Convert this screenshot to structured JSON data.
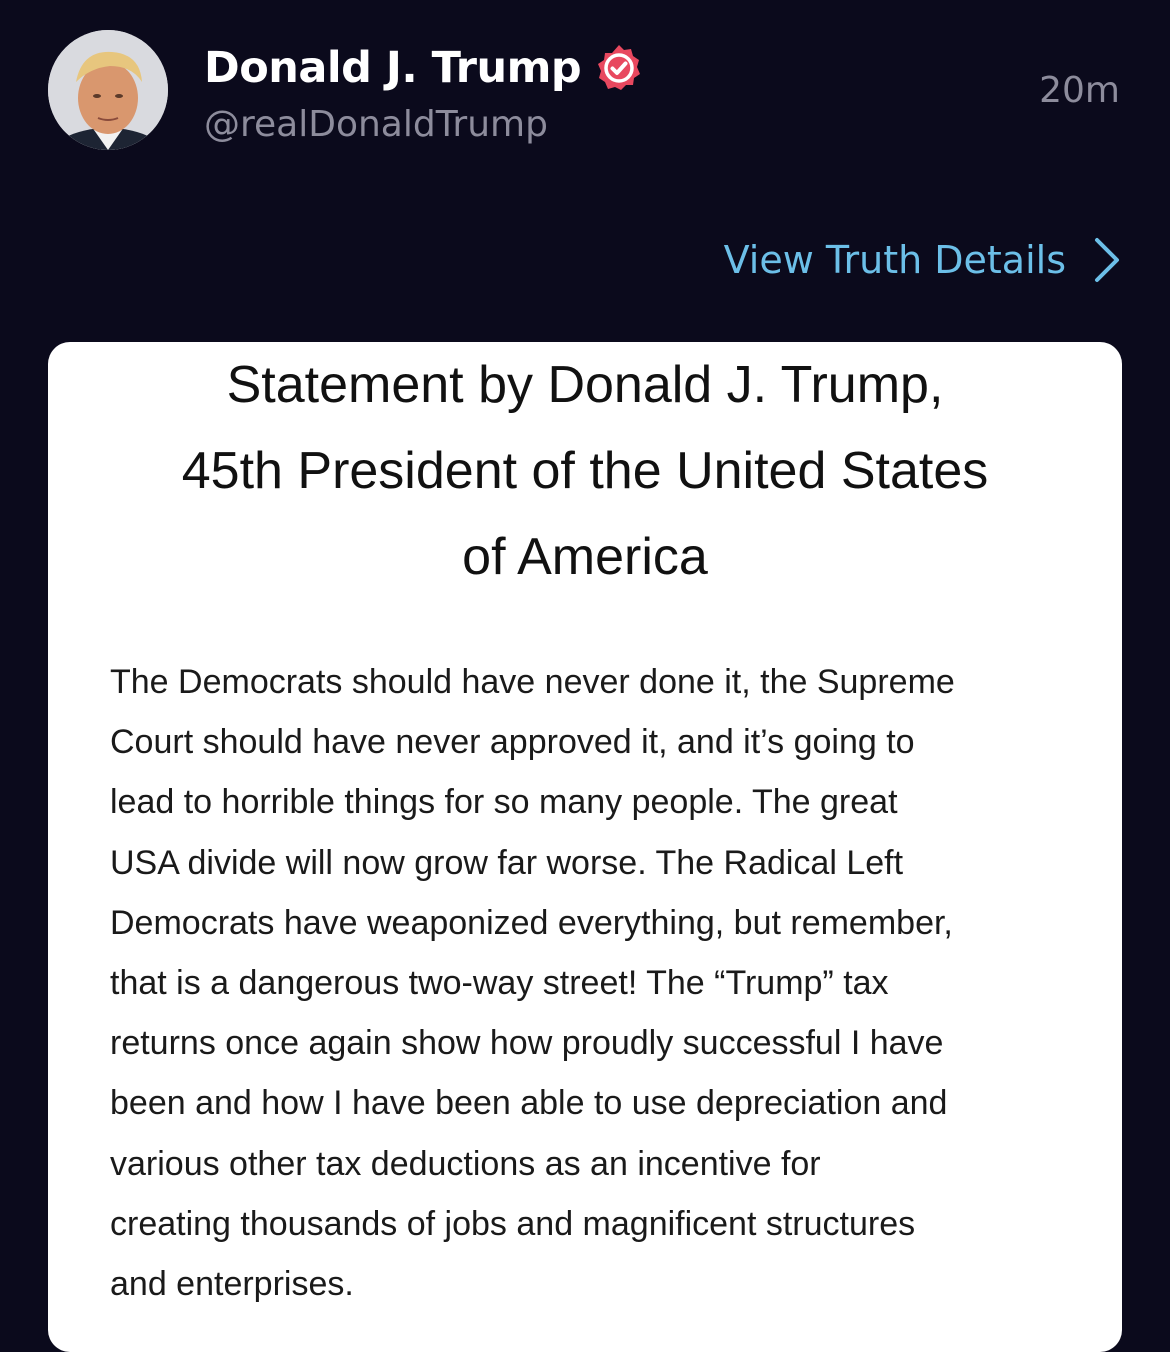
{
  "post": {
    "display_name": "Donald J. Trump",
    "handle": "@realDonaldTrump",
    "timestamp": "20m",
    "verified_icon": "verified-badge-icon",
    "avatar_icon": "profile-photo"
  },
  "details_link": {
    "label": "View Truth Details",
    "icon": "chevron-right-icon"
  },
  "statement": {
    "title_lines": [
      "Statement by Donald J. Trump,",
      "45th President of the United States",
      "of America"
    ],
    "body_lines": [
      "The Democrats should have never done it, the Supreme",
      "Court should have never approved it, and it’s going to",
      "lead to horrible things for so many people. The great",
      "USA divide will now grow far worse. The Radical Left",
      "Democrats have weaponized everything, but remember,",
      "that is a dangerous two-way street! The “Trump” tax",
      "returns once again show how proudly successful I have",
      "been and how I have been able to use depreciation and",
      "various other tax deductions as an incentive for",
      "creating thousands of jobs and magnificent structures",
      "and enterprises."
    ]
  },
  "colors": {
    "background": "#0b0a1c",
    "link": "#6cbfe8",
    "muted_text": "#8d8c9c",
    "verified_badge": "#e8485f",
    "card": "#ffffff"
  }
}
